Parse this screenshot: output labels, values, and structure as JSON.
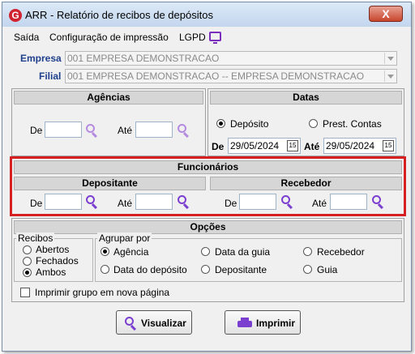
{
  "window": {
    "title": "ARR - Relatório de recibos de depósitos",
    "app_logo": "G",
    "close_label": "X"
  },
  "menu": {
    "saida": "Saída",
    "config": "Configuração de impressão",
    "lgpd": "LGPD"
  },
  "empresa": {
    "label": "Empresa",
    "value": "001 EMPRESA DEMONSTRACAO"
  },
  "filial": {
    "label": "Filial",
    "value": "001 EMPRESA DEMONSTRACAO -- EMPRESA DEMONSTRACAO"
  },
  "agencias": {
    "title": "Agências",
    "de": "De",
    "ate": "Até"
  },
  "datas": {
    "title": "Datas",
    "opt_deposito": "Depósito",
    "opt_prest": "Prest. Contas",
    "de": "De",
    "de_value": "29/05/2024",
    "ate": "Até",
    "ate_value": "29/05/2024",
    "cal_icon": "15"
  },
  "funcionarios": {
    "title": "Funcionários",
    "depositante": {
      "title": "Depositante",
      "de": "De",
      "ate": "Até"
    },
    "recebedor": {
      "title": "Recebedor",
      "de": "De",
      "ate": "Até"
    }
  },
  "opcoes": {
    "title": "Opções",
    "recibos": {
      "legend": "Recibos",
      "abertos": "Abertos",
      "fechados": "Fechados",
      "ambos": "Ambos"
    },
    "agrupar": {
      "legend": "Agrupar por",
      "agencia": "Agência",
      "data_guia": "Data da guia",
      "recebedor": "Recebedor",
      "data_deposito": "Data do depósito",
      "depositante": "Depositante",
      "guia": "Guia"
    },
    "imprimir_grupo": "Imprimir grupo em nova página"
  },
  "buttons": {
    "visualizar": "Visualizar",
    "imprimir": "Imprimir"
  },
  "colors": {
    "accent": "#7b3fd0",
    "highlight": "#d42020",
    "label_blue": "#1e3f8c"
  }
}
